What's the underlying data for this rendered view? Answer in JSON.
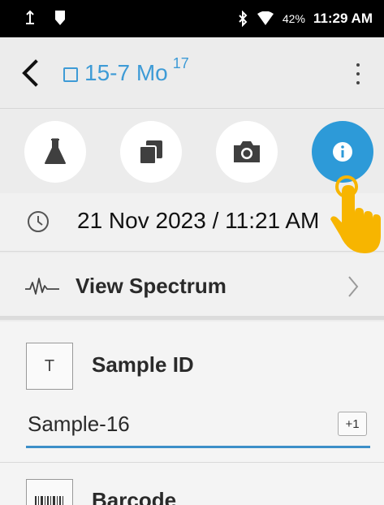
{
  "status_bar": {
    "battery_percent": "42%",
    "time": "11:29 AM",
    "icons": [
      "usb-icon",
      "shield-icon",
      "bluetooth-icon",
      "wifi-icon"
    ]
  },
  "app_bar": {
    "title": "15-7 Mo",
    "superscript": "17",
    "icons": [
      "back-arrow-icon",
      "square-icon",
      "more-vertical-icon"
    ]
  },
  "actions": [
    {
      "name": "flask-icon",
      "active": false
    },
    {
      "name": "copy-icon",
      "active": false
    },
    {
      "name": "camera-icon",
      "active": true
    },
    {
      "name": "info-icon",
      "active": true
    }
  ],
  "timestamp": {
    "text": "21 Nov 2023 / 11:21 AM"
  },
  "spectrum": {
    "label": "View Spectrum"
  },
  "sample_id": {
    "badge": "T",
    "label": "Sample ID",
    "value": "Sample-16",
    "increment": "+1"
  },
  "barcode": {
    "label": "Barcode"
  },
  "colors": {
    "accent": "#2d9ad8",
    "title": "#3e9bd6",
    "input_underline": "#3d8fc8",
    "pointer": "#f7b500"
  }
}
